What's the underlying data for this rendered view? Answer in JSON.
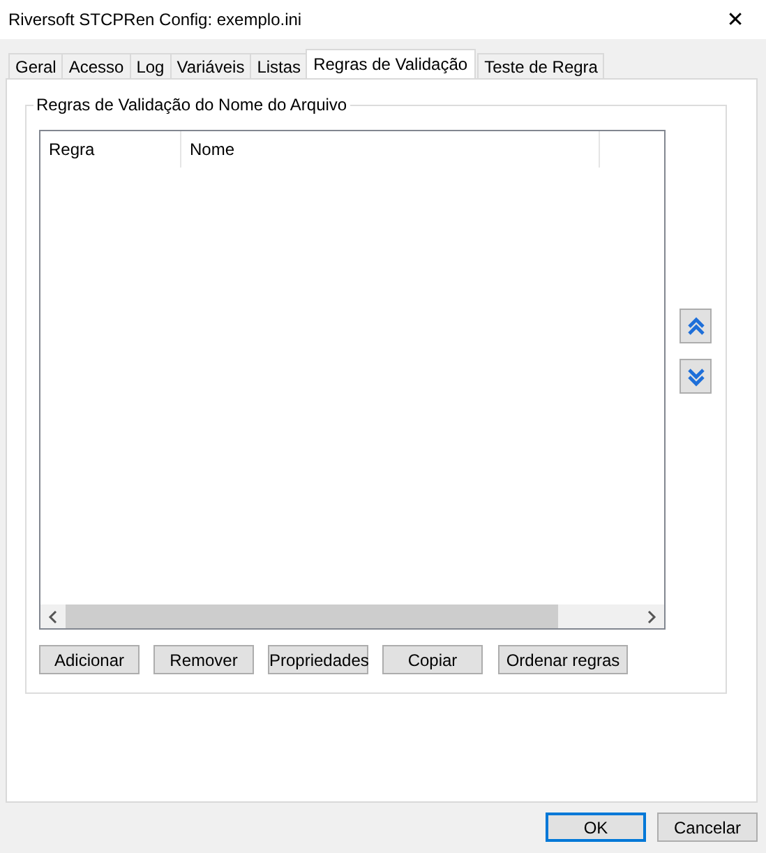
{
  "window": {
    "title": "Riversoft STCPRen Config: exemplo.ini",
    "close": "✕"
  },
  "tabs": [
    {
      "label": "Geral",
      "selected": false
    },
    {
      "label": "Acesso",
      "selected": false
    },
    {
      "label": "Log",
      "selected": false
    },
    {
      "label": "Variáveis",
      "selected": false
    },
    {
      "label": "Listas",
      "selected": false
    },
    {
      "label": "Regras de Validação",
      "selected": true
    },
    {
      "label": "Teste de Regra",
      "selected": false
    }
  ],
  "group": {
    "title": "Regras de Validação do Nome do Arquivo"
  },
  "table": {
    "columns": [
      "Regra",
      "Nome"
    ]
  },
  "rule_buttons": [
    "Adicionar",
    "Remover",
    "Propriedades",
    "Copiar",
    "Ordenar regras"
  ],
  "dialog_buttons": [
    {
      "label": "OK",
      "default": true
    },
    {
      "label": "Cancelar",
      "default": false
    }
  ]
}
